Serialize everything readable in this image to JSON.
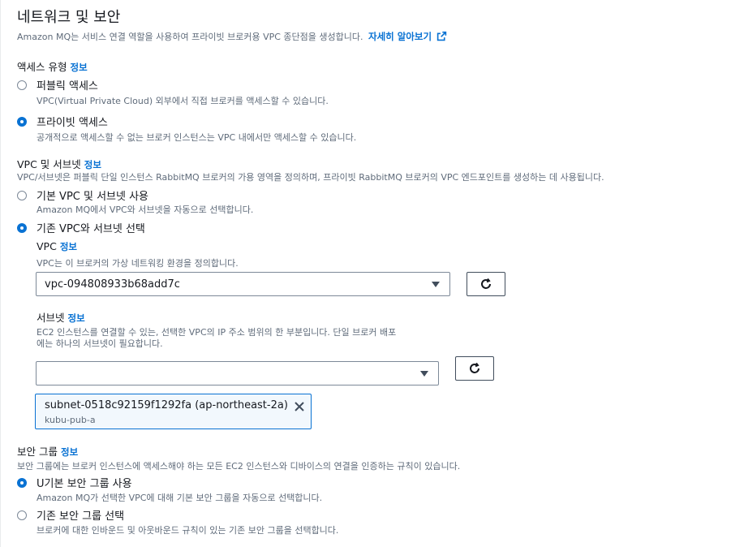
{
  "section": {
    "title": "네트워크 및 보안",
    "description": "Amazon MQ는 서비스 연결 역할을 사용하여 프라이빗 브로커용 VPC 종단점을 생성합니다.",
    "learn_more": "자세히 알아보기"
  },
  "info_label": "정보",
  "access_type": {
    "label": "액세스 유형",
    "options": [
      {
        "label": "퍼블릭 액세스",
        "description": "VPC(Virtual Private Cloud) 외부에서 직접 브로커를 액세스할 수 있습니다.",
        "selected": false
      },
      {
        "label": "프라이빗 액세스",
        "description": "공개적으로 액세스할 수 없는 브로커 인스턴스는 VPC 내에서만 액세스할 수 있습니다.",
        "selected": true
      }
    ]
  },
  "vpc_subnets": {
    "label": "VPC 및 서브넷",
    "description": "VPC/서브넷은 퍼블릭 단일 인스턴스 RabbitMQ 브로커의 가용 영역을 정의하며, 프라이빗 RabbitMQ 브로커의 VPC 엔드포인트를 생성하는 데 사용됩니다.",
    "options": [
      {
        "label": "기본 VPC 및 서브넷 사용",
        "description": "Amazon MQ에서 VPC와 서브넷을 자동으로 선택합니다.",
        "selected": false
      },
      {
        "label": "기존 VPC와 서브넷 선택",
        "selected": true
      }
    ],
    "vpc": {
      "label": "VPC",
      "description": "VPC는 이 브로커의 가상 네트워킹 환경을 정의합니다.",
      "value": "vpc-094808933b68add7c"
    },
    "subnet": {
      "label": "서브넷",
      "description_line1": "EC2 인스턴스를 연결할 수 있는, 선택한 VPC의 IP 주소 범위의 한 부분입니다. 단일 브로커 배포",
      "description_line2": "에는 하나의 서브넷이 필요합니다.",
      "value": "",
      "token": {
        "label": "subnet-0518c92159f1292fa (ap-northeast-2a)",
        "tag": "kubu-pub-a"
      }
    }
  },
  "security_group": {
    "label": "보안 그룹",
    "description": "보안 그룹에는 브로커 인스턴스에 액세스해야 하는 모든 EC2 인스턴스와 디바이스의 연결을 인증하는 규칙이 있습니다.",
    "options": [
      {
        "label": "U기본 보안 그룹 사용",
        "description": "Amazon MQ가 선택한 VPC에 대해 기본 보안 그룹을 자동으로 선택합니다.",
        "selected": true
      },
      {
        "label": "기존 보안 그룹 선택",
        "description": "브로커에 대한 인바운드 및 아웃바운드 규칙이 있는 기존 보안 그룹을 선택합니다.",
        "selected": false
      }
    ]
  },
  "icons": {
    "external_link": "external-link-icon",
    "refresh": "refresh-icon",
    "dropdown": "caret-down-icon",
    "remove": "close-icon"
  },
  "colors": {
    "accent": "#0972d3",
    "text": "#16191f",
    "muted": "#5f6b7a",
    "border": "#7d8998"
  }
}
